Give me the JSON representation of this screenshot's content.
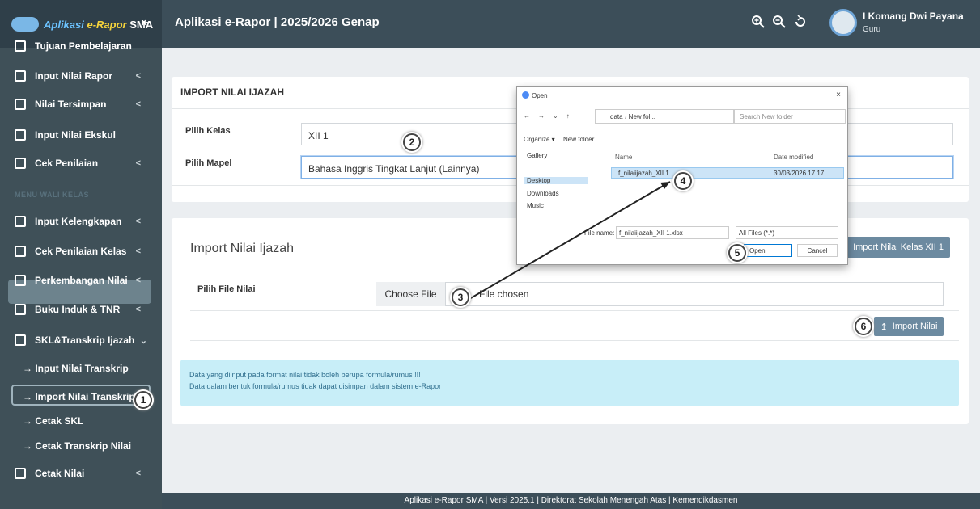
{
  "brand": {
    "part1": "Aplikasi ",
    "part2": "e-Rapor",
    "part3": " SMA",
    "toggle": "⇤"
  },
  "header": {
    "title": "Aplikasi e-Rapor | 2025/2026 Genap",
    "user_name": "I Komang Dwi Payana",
    "user_role": "Guru"
  },
  "sidebar": {
    "items": [
      {
        "label": "Tujuan Pembelajaran"
      },
      {
        "label": "Input Nilai Rapor",
        "chev": "<"
      },
      {
        "label": "Nilai Tersimpan",
        "chev": "<"
      },
      {
        "label": "Input Nilai Ekskul"
      },
      {
        "label": "Cek Penilaian",
        "chev": "<"
      },
      {
        "label": "Input Kelengkapan",
        "chev": "<"
      },
      {
        "label": "Cek Penilaian Kelas",
        "chev": "<"
      },
      {
        "label": "Perkembangan Nilai",
        "chev": "<"
      },
      {
        "label": "Buku Induk & TNR",
        "chev": "<"
      },
      {
        "label": "SKL&Transkrip Ijazah",
        "chev": "⌄"
      },
      {
        "label": "Cetak Nilai",
        "chev": "<"
      }
    ],
    "section_label": "MENU WALI KELAS",
    "subitems": [
      "→ Input Nilai Transkrip",
      "→ Import Nilai Transkrip",
      "→ Cetak SKL",
      "→ Cetak Transkrip Nilai"
    ]
  },
  "form": {
    "card_title": "IMPORT NILAI IJAZAH",
    "kelas_label": "Pilih Kelas",
    "kelas_value": "XII 1",
    "mapel_label": "Pilih Mapel",
    "mapel_value": "Bahasa Inggris Tingkat Lanjut (Lainnya)"
  },
  "import": {
    "title": "Import Nilai Ijazah",
    "kelas_button": "Import Nilai Kelas XII 1",
    "file_label": "Pilih File Nilai",
    "choose_button": "Choose File",
    "file_status": "File chosen",
    "import_button": "Import Nilai",
    "import_icon": "↥"
  },
  "info": {
    "line1": "Data yang diinput pada format nilai tidak boleh berupa formula/rumus !!!",
    "line2": "Data dalam bentuk formula/rumus tidak dapat disimpan dalam sistem e-Rapor"
  },
  "footer": {
    "text": "Aplikasi e-Rapor SMA | Versi 2025.1 | Direktorat Sekolah Menengah Atas | Kemendikdasmen"
  },
  "dialog": {
    "title": "Open",
    "close": "×",
    "nav": [
      "←",
      "→",
      "⌄",
      "↑"
    ],
    "address": "data › New fol...",
    "search_placeholder": "Search New folder",
    "organize": "Organize ▾",
    "new_folder": "New folder",
    "nav_items": [
      "Gallery",
      "Desktop",
      "Downloads",
      "Music"
    ],
    "col_name": "Name",
    "col_date": "Date modified",
    "file_name": "f_nilaiijazah_XII 1",
    "file_date": "30/03/2026 17.17",
    "filename_label": "File name:",
    "filename_value": "f_nilaiijazah_XII 1.xlsx",
    "filter": "All Files (*.*)",
    "open_button": "Open",
    "cancel_button": "Cancel"
  },
  "badges": [
    "1",
    "2",
    "3",
    "4",
    "5",
    "6"
  ]
}
